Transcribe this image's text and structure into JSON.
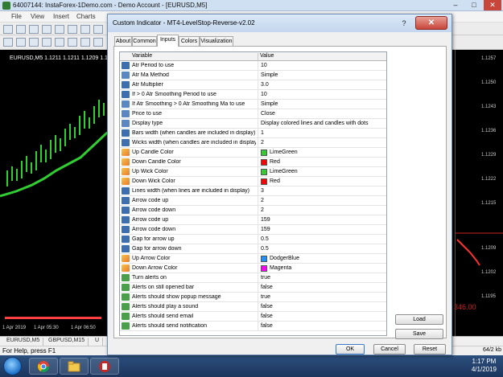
{
  "mt4": {
    "title": "64007144: InstaForex-1Demo.com - Demo Account - [EURUSD,M5]",
    "menu": [
      "File",
      "View",
      "Insert",
      "Charts"
    ],
    "chart_label": "EURUSD,M5  1.1211 1.1211 1.1209 1.1209",
    "price_ticks": [
      "1.1257",
      "1.1250",
      "1.1243",
      "1.1236",
      "1.1229",
      "1.1222",
      "1.1215",
      "1.1209",
      "1.1202",
      "1.1195"
    ],
    "time_ticks": [
      "1 Apr 2019",
      "1 Apr 05:30",
      "1 Apr 06:50"
    ],
    "chart_tabs": [
      "EURUSD,M5",
      "GBPUSD,M15",
      "U"
    ],
    "status": "For Help, press F1",
    "status_right": "64/2 kb",
    "price_badge": "346.00"
  },
  "taskbar": {
    "time": "1:17 PM",
    "date": "4/1/2019"
  },
  "dialog": {
    "title": "Custom Indicator - MT4-LevelStop-Reverse-v2.02",
    "help_label": "?",
    "close_label": "✕",
    "tabs": [
      "About",
      "Common",
      "Inputs",
      "Colors",
      "Visualization"
    ],
    "active_tab": "Inputs",
    "grid": {
      "columns": [
        "Variable",
        "Value"
      ],
      "rows": [
        {
          "icon": "num",
          "name": "Atr Period to use",
          "value": "10"
        },
        {
          "icon": "enum",
          "name": "Atr Ma Method",
          "value": "Simple"
        },
        {
          "icon": "num",
          "name": "Atr Multiplier",
          "value": "3.0"
        },
        {
          "icon": "num",
          "name": "If > 0 Atr Smoothing Period to use",
          "value": "10"
        },
        {
          "icon": "enum",
          "name": "If Atr Smoothing > 0 Atr Smoothing Ma to use",
          "value": "Simple"
        },
        {
          "icon": "enum",
          "name": "Price to use",
          "value": "Close"
        },
        {
          "icon": "enum",
          "name": "Display type",
          "value": "Display colored lines and candles with dots"
        },
        {
          "icon": "num",
          "name": "Bars width (when candles are included in display)",
          "value": "1"
        },
        {
          "icon": "num",
          "name": "Wicks width (when candles are included in display)",
          "value": "2"
        },
        {
          "icon": "color",
          "name": "Up Candle Color",
          "value": "LimeGreen",
          "swatch": "#32cd32"
        },
        {
          "icon": "color",
          "name": "Down Candle Color",
          "value": "Red",
          "swatch": "#ff0000"
        },
        {
          "icon": "color",
          "name": "Up Wick Color",
          "value": "LimeGreen",
          "swatch": "#32cd32"
        },
        {
          "icon": "color",
          "name": "Down Wick Color",
          "value": "Red",
          "swatch": "#ff0000"
        },
        {
          "icon": "num",
          "name": "Lines width (when lines are included in display)",
          "value": "3"
        },
        {
          "icon": "num",
          "name": "Arrow code up",
          "value": "2"
        },
        {
          "icon": "num",
          "name": "Arrow code down",
          "value": "2"
        },
        {
          "icon": "num",
          "name": "Arrow code up",
          "value": "159"
        },
        {
          "icon": "num",
          "name": "Arrow code down",
          "value": "159"
        },
        {
          "icon": "num",
          "name": "Gap for arrow up",
          "value": "0.5"
        },
        {
          "icon": "num",
          "name": "Gap for arrow down",
          "value": "0.5"
        },
        {
          "icon": "color",
          "name": "Up Arrow Color",
          "value": "DodgerBlue",
          "swatch": "#1e90ff"
        },
        {
          "icon": "color",
          "name": "Down Arrow Color",
          "value": "Magenta",
          "swatch": "#ff00ff"
        },
        {
          "icon": "bool",
          "name": "Turn alerts on",
          "value": "true"
        },
        {
          "icon": "bool",
          "name": "Alerts on still opened bar",
          "value": "false"
        },
        {
          "icon": "bool",
          "name": "Alerts should show popup message",
          "value": "true"
        },
        {
          "icon": "bool",
          "name": "Alerts should play a sound",
          "value": "false"
        },
        {
          "icon": "bool",
          "name": "Alerts should send email",
          "value": "false"
        },
        {
          "icon": "bool",
          "name": "Alerts should send notification",
          "value": "false"
        }
      ]
    },
    "buttons": {
      "load": "Load",
      "save": "Save",
      "ok": "OK",
      "cancel": "Cancel",
      "reset": "Reset"
    }
  }
}
